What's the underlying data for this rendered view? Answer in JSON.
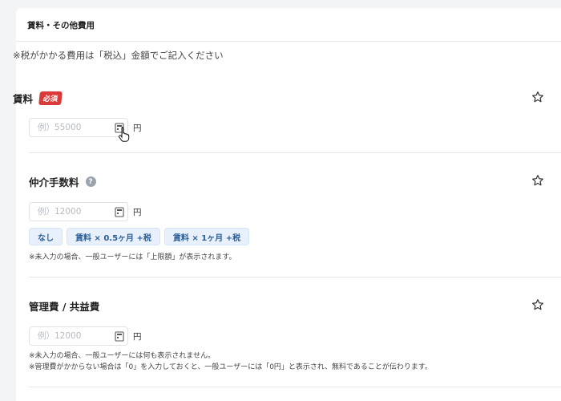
{
  "header": {
    "title": "賃料・その他費用"
  },
  "tax_note": "※税がかかる費用は「税込」金額でご記入ください",
  "sections": {
    "rent": {
      "label": "賃料",
      "required_badge": "必須",
      "placeholder": "例）55000",
      "unit": "円"
    },
    "brokerage": {
      "label": "仲介手数料",
      "help": "?",
      "placeholder": "例）12000",
      "unit": "円",
      "chips": [
        "なし",
        "賃料 × 0.5ヶ月 +税",
        "賃料 × 1ヶ月 +税"
      ],
      "note": "※未入力の場合、一般ユーザーには「上限額」が表示されます。"
    },
    "management": {
      "label": "管理費 / 共益費",
      "placeholder": "例）12000",
      "unit": "円",
      "note1": "※未入力の場合、一般ユーザーには何も表示されません。",
      "note2": "※管理費がかからない場合は「0」を入力しておくと、一般ユーザーには「0円」と表示され、無料であることが伝わります。"
    }
  },
  "colors": {
    "required": "#d93a3a",
    "chip_bg": "#e8f1fb",
    "chip_text": "#2a5d95"
  }
}
